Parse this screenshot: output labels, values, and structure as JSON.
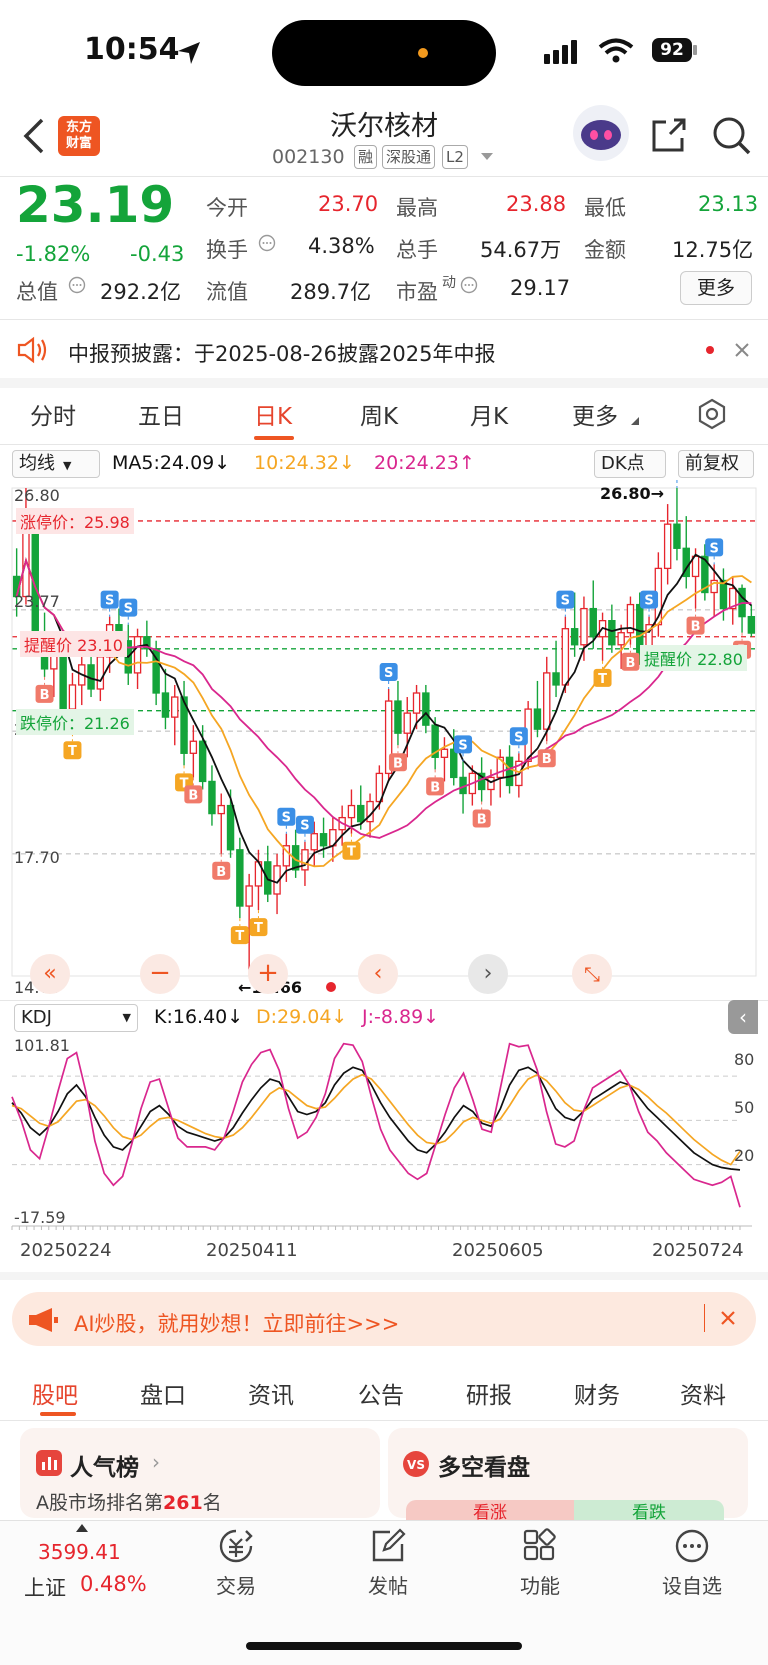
{
  "status_bar": {
    "time": "10:54",
    "battery": "92"
  },
  "header": {
    "logo_text_1": "东方",
    "logo_text_2": "财富",
    "stock_name": "沃尔核材",
    "stock_code": "002130",
    "tags": [
      "融",
      "深股通",
      "L2"
    ]
  },
  "quote": {
    "price": "23.19",
    "change_pct": "-1.82%",
    "change": "-0.43",
    "open_label": "今开",
    "open": "23.70",
    "high_label": "最高",
    "high": "23.88",
    "low_label": "最低",
    "low": "23.13",
    "turnover_label": "换手",
    "turnover": "4.38%",
    "volume_label": "总手",
    "volume": "54.67万",
    "amount_label": "金额",
    "amount": "12.75亿",
    "mktcap_label": "总值",
    "mktcap": "292.2亿",
    "float_label": "流值",
    "float": "289.7亿",
    "pe_label": "市盈",
    "pe_sup": "动",
    "pe": "29.17",
    "more": "更多"
  },
  "notice": {
    "text": "中报预披露：于2025-08-26披露2025年中报"
  },
  "ktabs": [
    "分时",
    "五日",
    "日K",
    "周K",
    "月K",
    "更多"
  ],
  "chart_controls": {
    "indicator": "均线",
    "ma5": "MA5:24.09↓",
    "ma10": "10:24.32↓",
    "ma20": "20:24.23↑",
    "dk": "DK点",
    "adjust": "前复权",
    "limit_up": "涨停价：25.98",
    "alert_a": "提醒价 23.10",
    "alert_b": "提醒价 22.80",
    "limit_down": "跌停价：21.26"
  },
  "chart_data": [
    {
      "type": "candlestick",
      "y_axis_labels": [
        "26.80",
        "23.77",
        "20.75",
        "17.70",
        "14.66"
      ],
      "ylim": [
        14.66,
        26.8
      ],
      "max_marker": "26.80→",
      "min_marker": "←14.66",
      "x_labels": [
        "20250224",
        "20250411",
        "20250605",
        "20250724"
      ],
      "legend": [
        "MA5:24.09↓",
        "10:24.32↓",
        "20:24.23↑"
      ],
      "ohlc": [
        [
          24.6,
          25.3,
          23.6,
          24.1
        ],
        [
          24.1,
          26.8,
          23.9,
          25.9
        ],
        [
          25.9,
          26.1,
          22.9,
          23.0
        ],
        [
          23.0,
          23.7,
          22.1,
          22.3
        ],
        [
          22.3,
          23.2,
          21.6,
          22.9
        ],
        [
          22.9,
          23.1,
          21.0,
          21.3
        ],
        [
          21.3,
          22.2,
          20.7,
          21.9
        ],
        [
          21.9,
          22.7,
          21.4,
          22.4
        ],
        [
          22.4,
          23.0,
          21.6,
          21.8
        ],
        [
          21.8,
          22.9,
          21.5,
          22.6
        ],
        [
          22.6,
          23.6,
          22.2,
          23.4
        ],
        [
          23.4,
          23.8,
          22.7,
          23.0
        ],
        [
          23.0,
          23.4,
          21.9,
          22.2
        ],
        [
          22.2,
          23.3,
          21.8,
          23.1
        ],
        [
          23.1,
          23.5,
          22.6,
          22.8
        ],
        [
          22.8,
          23.0,
          21.4,
          21.7
        ],
        [
          21.7,
          22.3,
          20.8,
          21.1
        ],
        [
          21.1,
          21.9,
          20.4,
          21.6
        ],
        [
          21.6,
          22.0,
          19.9,
          20.2
        ],
        [
          20.2,
          20.9,
          19.6,
          20.5
        ],
        [
          20.5,
          20.9,
          19.3,
          19.5
        ],
        [
          19.5,
          19.9,
          18.4,
          18.7
        ],
        [
          18.7,
          19.2,
          17.7,
          18.9
        ],
        [
          18.9,
          19.3,
          17.6,
          17.8
        ],
        [
          17.8,
          18.1,
          16.1,
          16.4
        ],
        [
          16.4,
          17.2,
          14.66,
          16.9
        ],
        [
          16.9,
          17.8,
          16.3,
          17.5
        ],
        [
          17.5,
          17.9,
          16.5,
          16.7
        ],
        [
          16.7,
          17.7,
          16.2,
          17.4
        ],
        [
          17.4,
          18.2,
          17.0,
          17.9
        ],
        [
          17.9,
          18.3,
          17.1,
          17.3
        ],
        [
          17.3,
          18.0,
          16.9,
          17.8
        ],
        [
          17.8,
          18.5,
          17.4,
          18.2
        ],
        [
          18.2,
          18.6,
          17.6,
          17.9
        ],
        [
          17.9,
          18.6,
          17.5,
          18.3
        ],
        [
          18.3,
          18.9,
          17.9,
          18.6
        ],
        [
          18.6,
          19.3,
          18.2,
          18.9
        ],
        [
          18.9,
          19.4,
          18.3,
          18.5
        ],
        [
          18.5,
          19.2,
          18.1,
          19.0
        ],
        [
          19.0,
          19.9,
          18.8,
          19.7
        ],
        [
          19.7,
          21.8,
          19.5,
          21.5
        ],
        [
          21.5,
          22.0,
          20.4,
          20.7
        ],
        [
          20.7,
          21.6,
          20.1,
          21.2
        ],
        [
          21.2,
          21.9,
          20.8,
          21.7
        ],
        [
          21.7,
          21.9,
          20.7,
          20.9
        ],
        [
          20.9,
          21.1,
          19.8,
          20.1
        ],
        [
          20.1,
          20.6,
          19.5,
          20.3
        ],
        [
          20.3,
          20.8,
          19.4,
          19.6
        ],
        [
          19.6,
          20.0,
          18.7,
          19.2
        ],
        [
          19.2,
          19.9,
          18.9,
          19.7
        ],
        [
          19.7,
          20.1,
          19.0,
          19.3
        ],
        [
          19.3,
          19.8,
          18.9,
          19.6
        ],
        [
          19.6,
          20.3,
          19.1,
          20.1
        ],
        [
          20.1,
          20.4,
          19.2,
          19.4
        ],
        [
          19.4,
          20.2,
          19.1,
          20.0
        ],
        [
          20.0,
          21.5,
          19.8,
          21.3
        ],
        [
          21.3,
          22.0,
          20.6,
          20.8
        ],
        [
          20.8,
          22.6,
          20.5,
          22.2
        ],
        [
          22.2,
          23.0,
          21.6,
          21.9
        ],
        [
          21.9,
          23.6,
          21.7,
          23.3
        ],
        [
          23.3,
          24.2,
          22.6,
          22.9
        ],
        [
          22.9,
          24.1,
          22.5,
          23.8
        ],
        [
          23.8,
          24.5,
          22.8,
          23.1
        ],
        [
          23.1,
          23.7,
          22.5,
          23.5
        ],
        [
          23.5,
          23.9,
          22.7,
          22.9
        ],
        [
          22.9,
          23.4,
          22.3,
          23.2
        ],
        [
          23.2,
          24.1,
          22.9,
          23.9
        ],
        [
          23.9,
          24.2,
          22.4,
          22.7
        ],
        [
          22.7,
          23.6,
          22.4,
          23.4
        ],
        [
          23.4,
          25.2,
          23.1,
          24.8
        ],
        [
          24.8,
          26.4,
          24.4,
          25.9
        ],
        [
          25.9,
          26.8,
          25.0,
          25.3
        ],
        [
          25.3,
          26.1,
          24.3,
          24.6
        ],
        [
          24.6,
          25.3,
          23.8,
          25.1
        ],
        [
          25.1,
          25.4,
          24.0,
          24.2
        ],
        [
          24.2,
          24.9,
          23.6,
          24.5
        ],
        [
          24.5,
          24.8,
          23.5,
          23.8
        ],
        [
          23.8,
          24.6,
          23.4,
          24.3
        ],
        [
          24.3,
          24.4,
          23.2,
          23.6
        ],
        [
          23.6,
          23.9,
          23.1,
          23.19
        ]
      ],
      "signal_legend": {
        "buy": "B",
        "sell": "S",
        "t": "T"
      }
    },
    {
      "type": "line",
      "indicator": "KDJ",
      "legend": [
        "K:16.40↓",
        "D:29.04↓",
        "J:-8.89↓"
      ],
      "y_axis_labels": [
        "101.81",
        "-17.59"
      ],
      "ylim": [
        -17.59,
        101.81
      ],
      "ref_lines": [
        "80",
        "50",
        "20"
      ],
      "series": [
        {
          "name": "K",
          "values": [
            62,
            55,
            45,
            40,
            46,
            56,
            68,
            74,
            66,
            52,
            40,
            32,
            30,
            36,
            46,
            56,
            60,
            54,
            46,
            42,
            40,
            38,
            36,
            38,
            45,
            55,
            64,
            72,
            78,
            76,
            66,
            56,
            54,
            56,
            62,
            74,
            82,
            86,
            84,
            74,
            62,
            52,
            44,
            36,
            30,
            28,
            34,
            42,
            52,
            60,
            56,
            48,
            46,
            58,
            74,
            84,
            86,
            82,
            70,
            58,
            52,
            50,
            56,
            64,
            68,
            72,
            76,
            74,
            66,
            58,
            52,
            46,
            40,
            34,
            28,
            24,
            20,
            18,
            17,
            16.4
          ]
        },
        {
          "name": "D",
          "values": [
            60,
            58,
            53,
            48,
            46,
            49,
            56,
            63,
            64,
            60,
            53,
            45,
            39,
            37,
            40,
            46,
            51,
            52,
            50,
            47,
            44,
            41,
            39,
            38,
            40,
            45,
            52,
            60,
            68,
            72,
            70,
            65,
            60,
            58,
            59,
            65,
            72,
            78,
            81,
            78,
            71,
            63,
            55,
            47,
            40,
            35,
            34,
            36,
            42,
            49,
            52,
            50,
            48,
            51,
            60,
            70,
            78,
            81,
            77,
            70,
            62,
            57,
            56,
            60,
            64,
            68,
            72,
            74,
            71,
            66,
            60,
            55,
            49,
            43,
            37,
            32,
            27,
            23,
            20,
            29.04
          ]
        },
        {
          "name": "J",
          "values": [
            66,
            50,
            30,
            24,
            46,
            70,
            92,
            96,
            70,
            36,
            14,
            6,
            12,
            34,
            58,
            76,
            78,
            58,
            38,
            32,
            32,
            32,
            30,
            38,
            56,
            76,
            88,
            96,
            98,
            84,
            58,
            38,
            42,
            52,
            68,
            92,
            102,
            101,
            90,
            66,
            44,
            30,
            22,
            14,
            10,
            14,
            34,
            54,
            72,
            82,
            64,
            44,
            42,
            72,
            102,
            100,
            101,
            84,
            56,
            34,
            32,
            36,
            56,
            72,
            76,
            80,
            84,
            74,
            56,
            42,
            36,
            28,
            22,
            16,
            10,
            8,
            6,
            8,
            12,
            -8.89
          ]
        }
      ],
      "x_labels": [
        "20250224",
        "20250411",
        "20250605",
        "20250724"
      ]
    }
  ],
  "kdj_selector": "KDJ",
  "ai_banner": {
    "text": "AI炒股，就用妙想！立即前往>>>"
  },
  "bottom_tabs": [
    "股吧",
    "盘口",
    "资讯",
    "公告",
    "研报",
    "财务",
    "资料"
  ],
  "cards": {
    "popularity_title": "人气榜",
    "popularity_sub_prefix": "A股市场排名第",
    "popularity_rank": "261",
    "popularity_sub_suffix": "名",
    "bullbear_title": "多空看盘",
    "bull": "看涨",
    "bear": "看跌"
  },
  "bottom_nav": {
    "index_value": "3599.41",
    "index_name": "上证",
    "index_change": "0.48%",
    "items": [
      "交易",
      "发帖",
      "功能",
      "设自选"
    ]
  },
  "colors": {
    "up": "#e6252d",
    "down": "#14a43a",
    "ma5": "#111111",
    "ma10": "#f5a623",
    "ma20": "#d9278e",
    "accent": "#ee5522"
  }
}
